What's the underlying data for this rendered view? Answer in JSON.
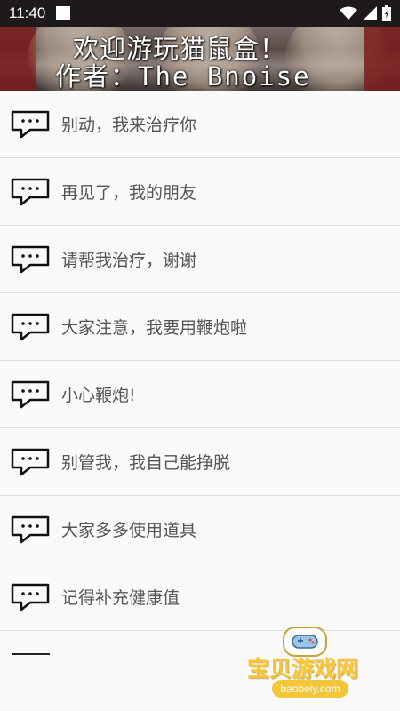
{
  "status_bar": {
    "time": "11:40"
  },
  "banner": {
    "line1": "欢迎游玩猫鼠盒！",
    "line2": "作者：The_Bnoise"
  },
  "messages": [
    "别动，我来治疗你",
    "再见了，我的朋友",
    "请帮我治疗，谢谢",
    "大家注意，我要用鞭炮啦",
    "小心鞭炮!",
    "别管我，我自己能挣脱",
    "大家多多使用道具",
    "记得补充健康值"
  ],
  "watermark": {
    "name": "宝贝游戏网",
    "url": "baobeiy.com"
  }
}
